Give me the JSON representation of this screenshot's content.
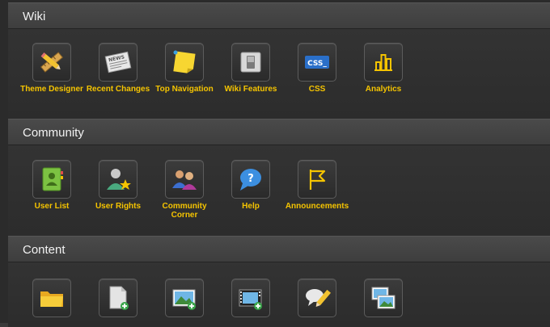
{
  "sections": [
    {
      "title": "Wiki",
      "items": [
        {
          "label": "Theme Designer",
          "icon": "theme-designer-icon"
        },
        {
          "label": "Recent Changes",
          "icon": "newspaper-icon"
        },
        {
          "label": "Top Navigation",
          "icon": "sticky-note-icon"
        },
        {
          "label": "Wiki Features",
          "icon": "toggle-switch-icon"
        },
        {
          "label": "CSS",
          "icon": "css-icon",
          "badge": "CSS_"
        },
        {
          "label": "Analytics",
          "icon": "bar-chart-icon"
        }
      ]
    },
    {
      "title": "Community",
      "items": [
        {
          "label": "User List",
          "icon": "address-book-icon"
        },
        {
          "label": "User Rights",
          "icon": "user-star-icon"
        },
        {
          "label": "Community Corner",
          "icon": "users-icon"
        },
        {
          "label": "Help",
          "icon": "help-bubble-icon",
          "badge": "?"
        },
        {
          "label": "Announcements",
          "icon": "flag-icon"
        }
      ]
    },
    {
      "title": "Content",
      "items": [
        {
          "label": "",
          "icon": "folder-icon"
        },
        {
          "label": "",
          "icon": "new-page-icon"
        },
        {
          "label": "",
          "icon": "add-image-icon"
        },
        {
          "label": "",
          "icon": "add-video-icon"
        },
        {
          "label": "",
          "icon": "edit-comment-icon"
        },
        {
          "label": "",
          "icon": "photo-gallery-icon"
        }
      ]
    }
  ],
  "colors": {
    "label": "#f5c400",
    "header_text": "#f2f2f2",
    "background": "#2b2b2b"
  }
}
